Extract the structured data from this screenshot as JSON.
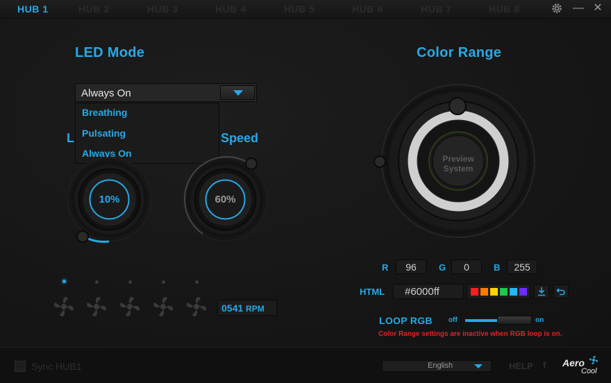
{
  "tabs": [
    "HUB 1",
    "HUB 2",
    "HUB 3",
    "HUB 4",
    "HUB 5",
    "HUB 6",
    "HUB 7",
    "HUB 8"
  ],
  "active_tab": "HUB 1",
  "window": {
    "settings_icon": "gear-icon",
    "minimize_glyph": "—",
    "close_glyph": "✕"
  },
  "led_mode": {
    "title": "LED Mode",
    "selected": "Always On",
    "options": [
      "Breathing",
      "Pulsating",
      "Always On"
    ]
  },
  "left_label_fragment": "L",
  "speed_label": "Speed",
  "knobs": {
    "brightness_value": "10%",
    "speed_value": "60%"
  },
  "fans": {
    "count": 5,
    "active_index": 0,
    "rpm_number": "0541",
    "rpm_unit": "RPM"
  },
  "color_range": {
    "title": "Color Range",
    "preview_line1": "Preview",
    "preview_line2": "System",
    "r_label": "R",
    "r_value": "96",
    "g_label": "G",
    "g_value": "0",
    "b_label": "B",
    "b_value": "255",
    "html_label": "HTML",
    "html_value": "#6000ff",
    "swatches": [
      "#ff1c1c",
      "#ff7a00",
      "#ffd400",
      "#22c74a",
      "#25b5ef",
      "#6a2cff"
    ],
    "loop_label": "LOOP  RGB",
    "toggle_off": "off",
    "toggle_on": "on",
    "warning": "Color Range settings are inactive when RGB loop is on."
  },
  "bottom": {
    "sync_label": "Sync HUB1",
    "language": "English",
    "help": "HELP",
    "facebook": "f",
    "logo_line1": "Aero",
    "logo_line2": "Cool"
  },
  "colors": {
    "accent": "#27a9e6",
    "warning": "#e0232b"
  }
}
